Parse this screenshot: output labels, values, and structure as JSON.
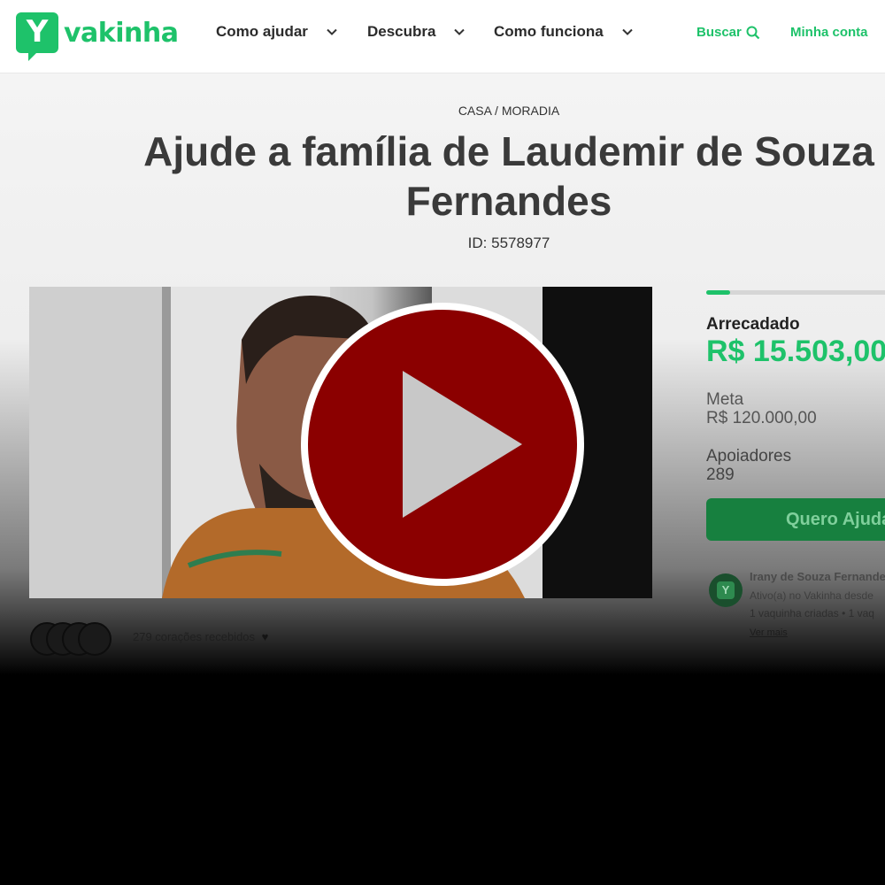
{
  "header": {
    "logo_text": "vakinha",
    "logo_glyph": "Y",
    "nav": [
      {
        "label": "Como ajudar"
      },
      {
        "label": "Descubra"
      },
      {
        "label": "Como funciona"
      }
    ],
    "search_label": "Buscar",
    "account_label": "Minha conta"
  },
  "campaign": {
    "category": "CASA / MORADIA",
    "title_line1": "Ajude a família de Laudemir de Souza",
    "title_line2": "Fernandes",
    "id_text": "ID: 5578977"
  },
  "stats": {
    "raised_label": "Arrecadado",
    "raised_value": "R$ 15.503,00",
    "goal_label": "Meta",
    "goal_value": "R$ 120.000,00",
    "supporters_label": "Apoiadores",
    "supporters_value": "289",
    "progress_fraction": 0.13,
    "cta_label": "Quero Ajudar"
  },
  "organizer": {
    "name": "Irany de Souza Fernandes",
    "active_text": "Ativo(a) no Vakinha desde",
    "count_text": "1 vaquinha criadas",
    "count_text_2": "1 vaq",
    "more_link": "Ver mais"
  },
  "hearts": {
    "text": "279 corações recebidos"
  },
  "colors": {
    "brand_green": "#1ec26a",
    "play_red": "#8b0000"
  }
}
